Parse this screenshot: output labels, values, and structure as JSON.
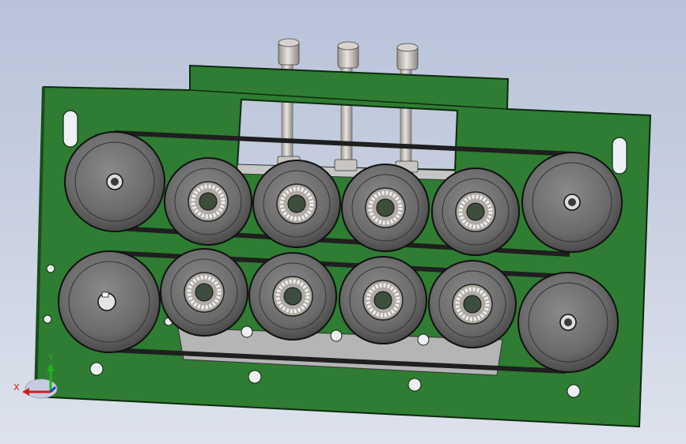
{
  "viewport": {
    "background_top": "#b9c3d8",
    "background_bottom": "#dde2ec"
  },
  "model": {
    "plate_color": "#2e7d32",
    "plate_edge": "#0d2a10",
    "roller_color": "#6e6e6e",
    "belt_color": "#2a2a2a",
    "bolt_color": "#c9c4c0",
    "upper_row_rollers": 6,
    "lower_row_rollers": 6,
    "bolts": 3
  },
  "triad": {
    "x_label": "X",
    "y_label": "Y",
    "x_color": "#d21c1c",
    "y_color": "#1fb31f",
    "z_color": "#1c3fd2"
  }
}
